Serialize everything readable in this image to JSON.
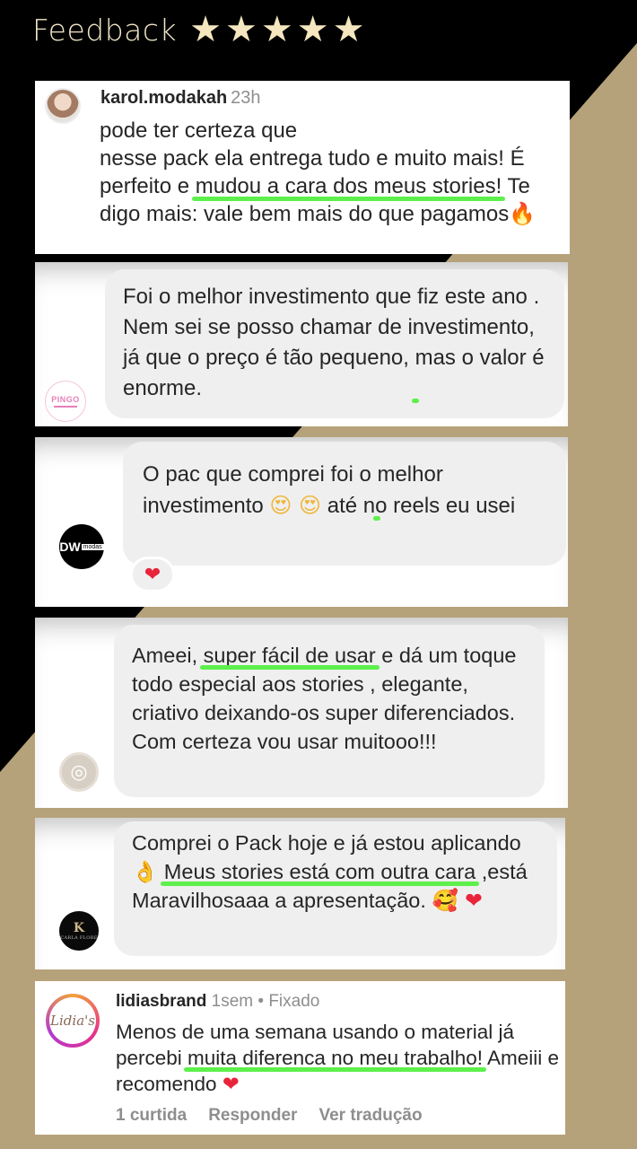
{
  "header": {
    "title": "Feedback",
    "stars": 5
  },
  "colors": {
    "gold": "#b7a37a",
    "highlight": "#5df04c",
    "bubble": "#efefef"
  },
  "comment1": {
    "username": "karol.modakah",
    "time": "23h",
    "line1": "pode ter certeza que",
    "line2a": "nesse pack ela entrega tudo e muito mais! É perfeito e ",
    "highlight": "mudou a cara dos meus stories!",
    "line2b": " Te digo mais: vale bem mais do que pagamos",
    "emoji": "🔥"
  },
  "message2": {
    "avatar_text": "PINGO",
    "text_a": "Foi o melhor investimento que fiz este ano . Nem sei se posso chamar de investimento, já que o preço é tão pequeno, ",
    "highlight": "mas o valor é enorme",
    "text_b": "."
  },
  "message3": {
    "avatar_text": "DW",
    "avatar_sub": "modas",
    "text_a": "O pac que comprei foi o ",
    "highlight": "melhor investimento",
    "emojis": "😍 😍",
    "text_b": " até no reels eu usei",
    "reaction": "❤"
  },
  "message4": {
    "text_a": "Ameei, ",
    "highlight": "super fácil de usar",
    "text_b": " e dá um toque todo especial aos stories , elegante, criativo deixando-os super diferenciados. Com certeza vou usar muitooo!!!"
  },
  "message5": {
    "avatar_text": "K",
    "avatar_sub": "CARLA FLORE",
    "text_a": "Comprei o Pack hoje e já estou aplicando",
    "emoji_hand": "👌",
    "highlight": "Meus stories está com outra cara",
    "text_b": " ,está Maravilhosaaa a apresentação. ",
    "emojis_end": "🥰 ❤"
  },
  "comment6": {
    "username": "lidiasbrand",
    "time": "1sem",
    "dot": "•",
    "pinned": "Fixado",
    "avatar_text": "Lidia's",
    "text_a": "Menos de uma semana usando o material já percebi ",
    "highlight": "muita diferenca no meu trabalho!",
    "text_b": " Ameiii e recomendo ",
    "emoji": "❤",
    "likes": "1 curtida",
    "reply": "Responder",
    "translate": "Ver tradução"
  }
}
